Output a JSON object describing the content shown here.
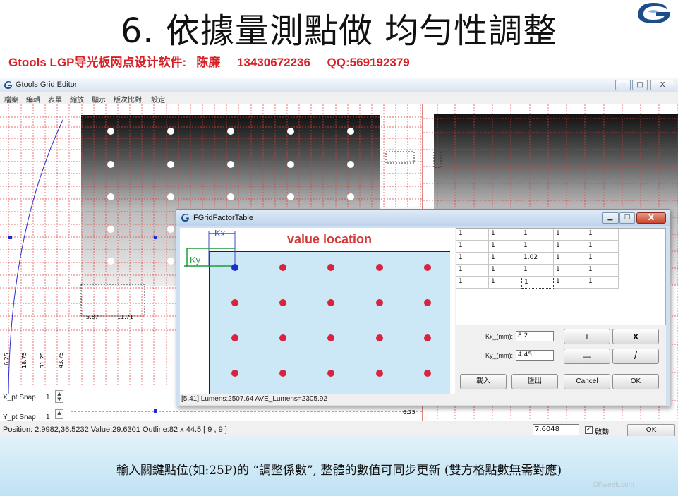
{
  "slide": {
    "title": "6. 依據量測點做 均勻性調整",
    "subtitle": "Gtools LGP导光板网点设计软件:   陈廉     13430672236     QQ:569192379",
    "caption": "輸入關鍵點位(如:25P)的 “調整係數”, 整體的數值可同步更新 (雙方格點數無需對應)",
    "watermark": "OFweek.com"
  },
  "window": {
    "title": "Gtools Grid Editor",
    "controls": {
      "minimize": "—",
      "maximize": "□",
      "close": "X"
    },
    "menu": [
      "檔案",
      "編輯",
      "表單",
      "縮放",
      "顯示",
      "版次比對",
      "設定"
    ]
  },
  "left_canvas": {
    "ruler_labels": [
      "6.25",
      "18.75",
      "31.25",
      "43.75"
    ],
    "dimension_labels": [
      "5.87",
      "11.71"
    ],
    "bottom_label": "6.25"
  },
  "snap": {
    "x_label": "X_pt Snap",
    "x_value": "1",
    "y_label": "Y_pt Snap",
    "y_value": "1"
  },
  "statusbar": {
    "position": "Position: 2.9982,36.5232 Value:29.6301 Outline:82 x 44.5 [ 9 , 9 ]",
    "input_value": "7.6048",
    "checkbox_label": "啟動",
    "checkbox_checked": true,
    "ok_label": "OK"
  },
  "dialog": {
    "title": "FGridFactorTable",
    "value_location_label": "value location",
    "kx_tag": "Kx",
    "ky_tag": "Ky",
    "table": [
      [
        "1",
        "1",
        "1",
        "1",
        "1"
      ],
      [
        "1",
        "1",
        "1",
        "1",
        "1"
      ],
      [
        "1",
        "1",
        "1.02",
        "1",
        "1"
      ],
      [
        "1",
        "1",
        "1",
        "1",
        "1"
      ],
      [
        "1",
        "1",
        "1",
        "1",
        "1"
      ]
    ],
    "kx_label": "Kx_(mm):",
    "kx_value": "8.2",
    "ky_label": "Ky_(mm):",
    "ky_value": "4.45",
    "op_plus": "+",
    "op_times": "x",
    "op_minus": "—",
    "op_divide": "/",
    "import_label": "載入",
    "export_label": "匯出",
    "cancel_label": "Cancel",
    "ok_label": "OK",
    "status": "[5.41] Lumens:2507.64 AVE_Lumens=2305.92"
  },
  "colors": {
    "accent_red": "#d91f26",
    "grid_red": "#e23b3b",
    "dot_red": "#d9233f",
    "dot_blue": "#1a2fd1",
    "dialog_blue": "#cce7f6"
  }
}
